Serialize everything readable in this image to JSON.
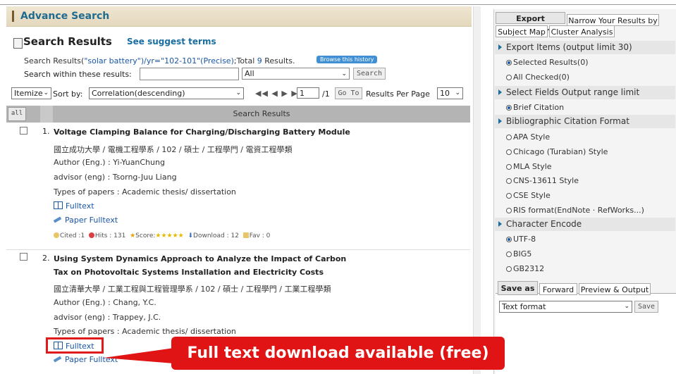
{
  "header": {
    "title": "Advance Search"
  },
  "results_head": {
    "title": "Search Results",
    "suggest": "See suggest terms"
  },
  "query": {
    "prefix": "Search Results(",
    "query_text": "\"solar battery\")/yr=\"102-101\"(Precise)",
    "suffix": ";Total ",
    "total": "9",
    "results_word": " Results.",
    "history_btn": "Browse this history"
  },
  "within": {
    "label": "Search within these results:",
    "scope": "All",
    "search_btn": "Search"
  },
  "toolbar": {
    "itemize": "Itemize",
    "sort_label": "Sort by:",
    "sort_value": "Correlation(descending)",
    "pager_icons": "◀◀ ◀ ▶ ▶▶",
    "page": "1",
    "page_total": "/1",
    "goto_btn": "Go To",
    "rpp_label": "Results Per Page",
    "rpp_value": "10"
  },
  "table": {
    "all_btn": "all",
    "header": "Search Results"
  },
  "results": [
    {
      "num": "1.",
      "title": "Voltage Clamping Balance for Charging/Discharging Battery Module",
      "school": "國立成功大學 / 電機工程學系 / 102 / 碩士 / 工程學門 / 電資工程學類",
      "author": "Author (Eng.) : Yi-YuanChung",
      "advisor": "advisor (eng) : Tsorng-Juu Liang",
      "type": "Types of papers : Academic thesis/ dissertation",
      "fulltext": "Fulltext",
      "paper_fulltext": "Paper Fulltext",
      "cited": "Cited :1",
      "hits": "Hits : 131",
      "score": "Score:",
      "score_stars": "★★★★★",
      "download": "Download : 12",
      "fav": "Fav : 0"
    },
    {
      "num": "2.",
      "title_line1": "Using System Dynamics Approach to Analyze the Impact of Carbon",
      "title_line2": "Tax on Photovoltaic Systems Installation and Electricity Costs",
      "school": "國立清華大學 / 工業工程與工程管理學系 / 102 / 碩士 / 工程學門 / 工業工程學類",
      "author": "Author (Eng.) : Chang, Y.C.",
      "advisor": "advisor (eng) : Trappey, J.C.",
      "type": "Types of papers : Academic thesis/ dissertation",
      "fulltext": "Fulltext",
      "paper_fulltext": "Paper Fulltext"
    }
  ],
  "right_panel": {
    "tabs": [
      "Export Manager",
      "Narrow Your Results by",
      "Subject Map",
      "Cluster Analysis"
    ],
    "export_items": {
      "head": "Export Items (output limit 30)",
      "opts": [
        "Selected Results(0)",
        "All Checked(0)"
      ]
    },
    "select_fields": {
      "head": "Select Fields Output range limit",
      "opts": [
        "Brief Citation"
      ]
    },
    "citation": {
      "head": "Bibliographic Citation Format",
      "opts": [
        "APA Style",
        "Chicago (Turabian) Style",
        "MLA Style",
        "CNS-13611 Style",
        "CSE Style",
        "RIS format(EndNote · RefWorks...)"
      ]
    },
    "encode": {
      "head": "Character Encode",
      "opts": [
        "UTF-8",
        "BIG5",
        "GB2312"
      ]
    },
    "bottom_tabs": [
      "Save as",
      "Forward",
      "Preview & Output"
    ],
    "format": "Text format",
    "save_btn": "Save"
  },
  "callout": {
    "text": "Full text download available (free)"
  },
  "colors": {
    "accent_blue": "#1a6ea0",
    "callout_red": "#e01414",
    "header_bg": "#e9dfc8"
  }
}
